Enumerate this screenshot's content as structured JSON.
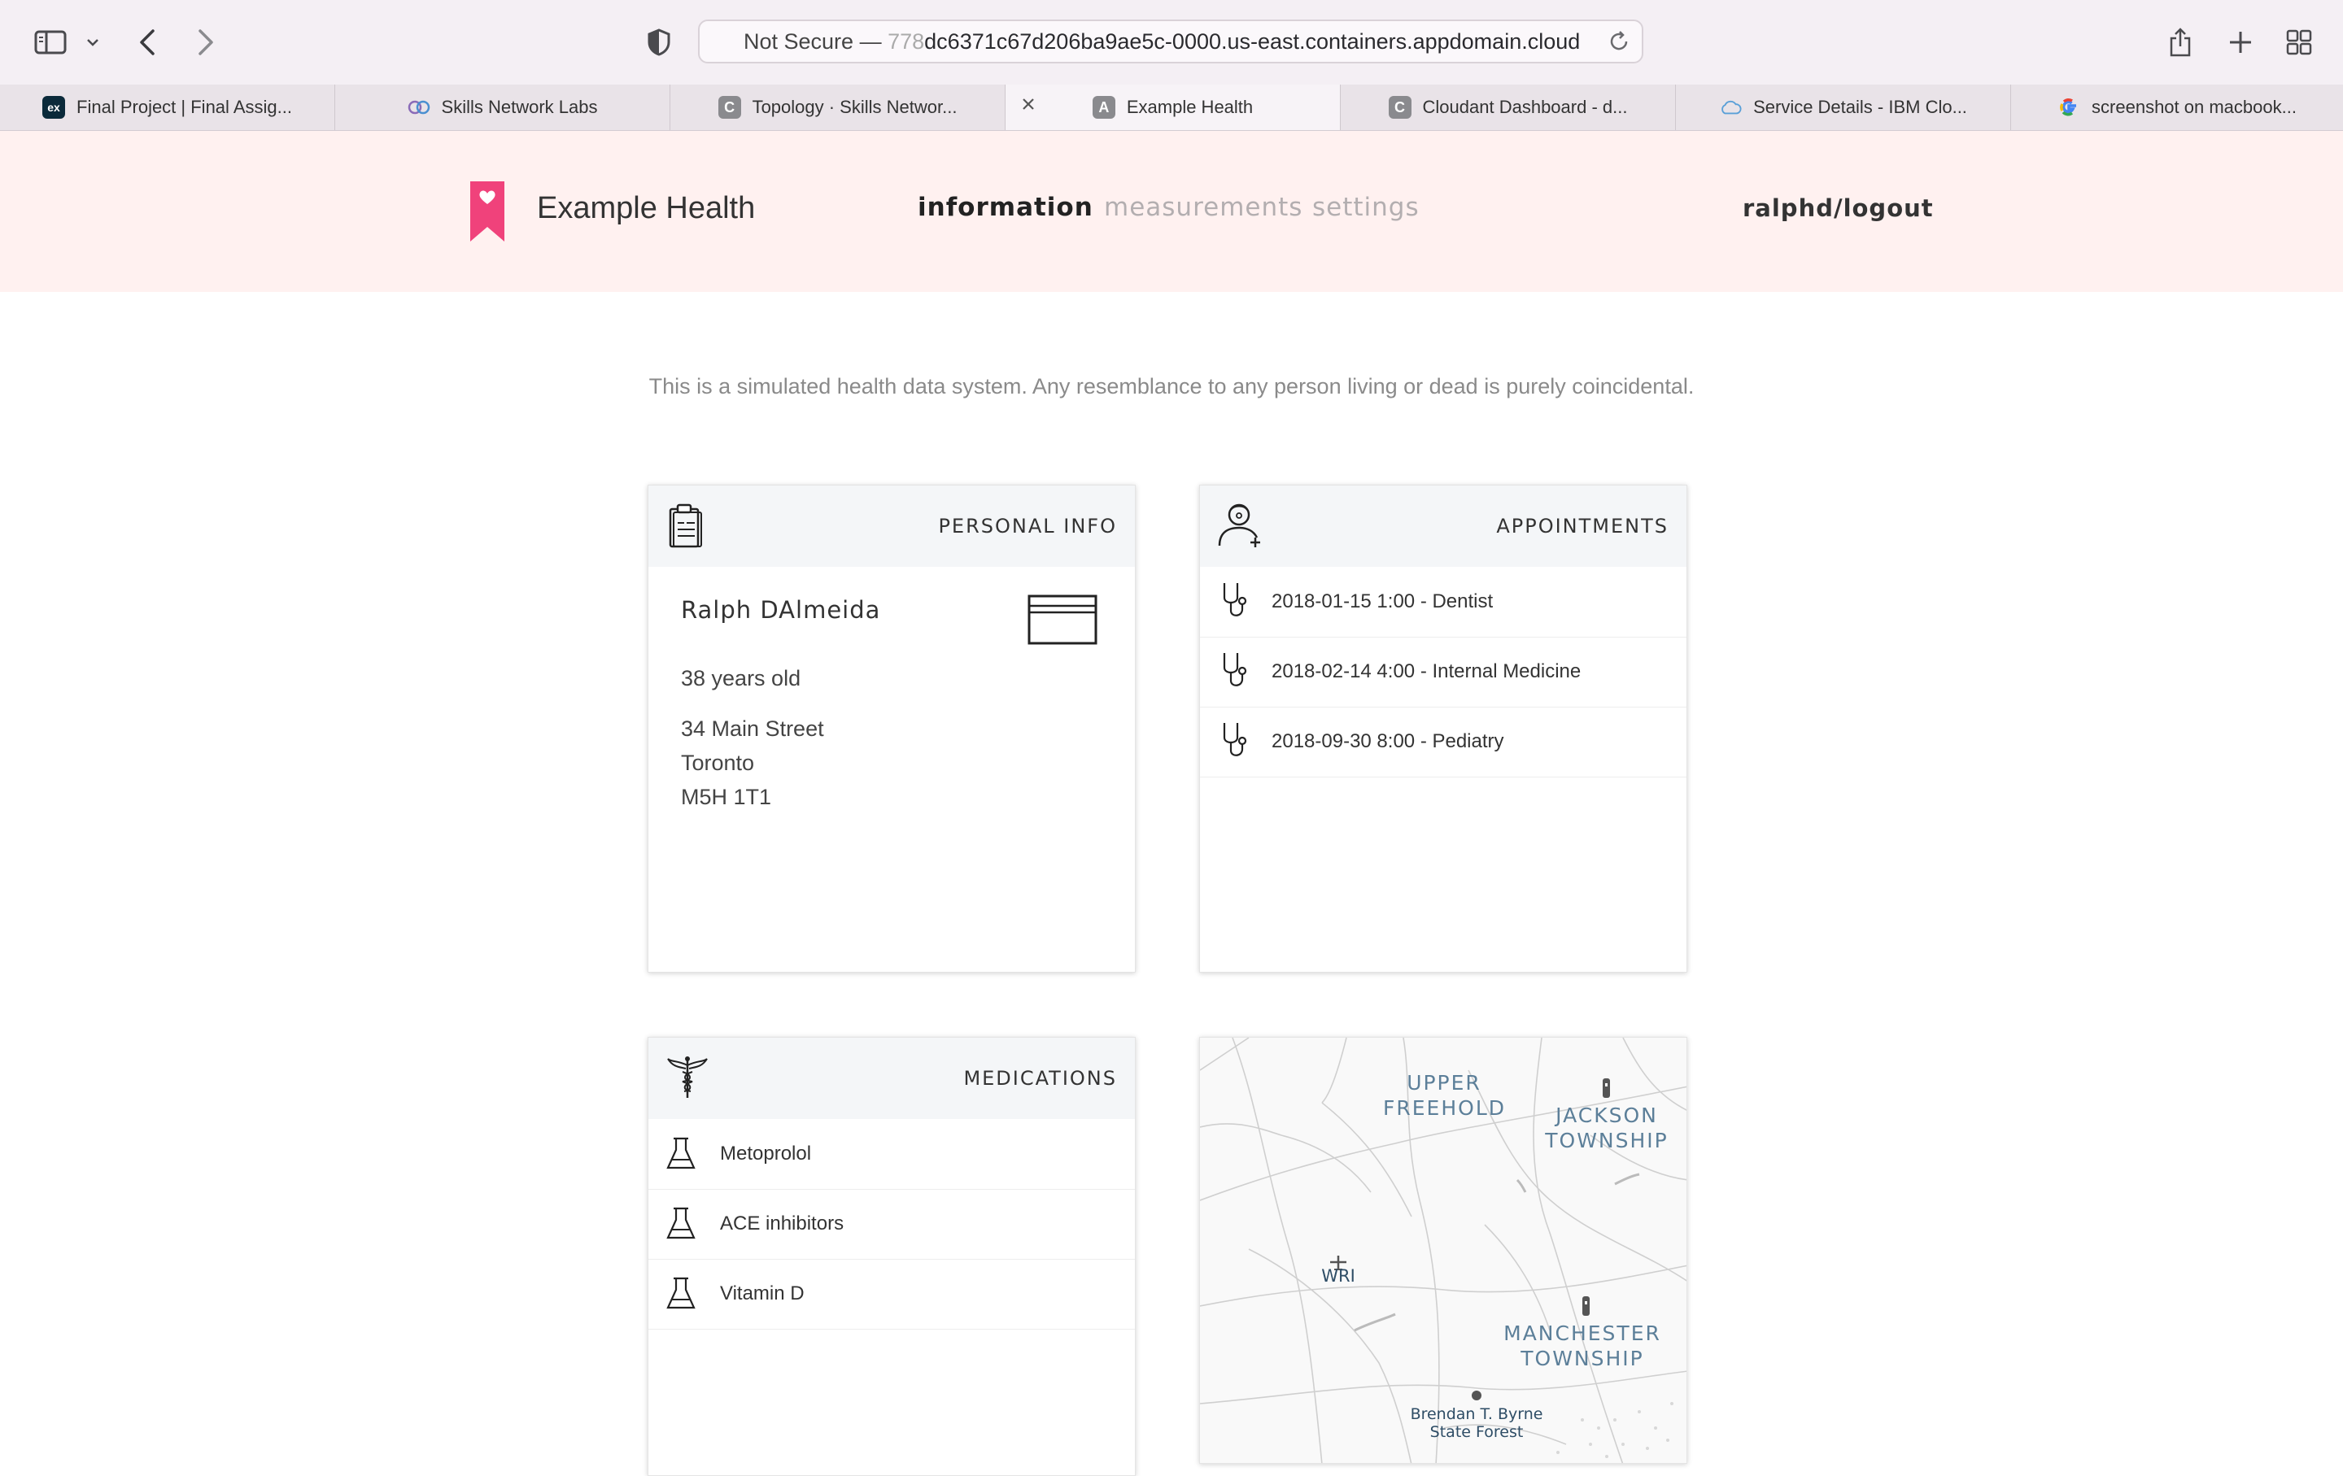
{
  "browser": {
    "address_prefix": "Not Secure —",
    "address_faded": "778",
    "address_url": "dc6371c67d206ba9ae5c-0000.us-east.containers.appdomain.cloud",
    "tabs": [
      {
        "label": "Final Project | Final Assig...",
        "favicon": "edx"
      },
      {
        "label": "Skills Network Labs",
        "favicon": "skills"
      },
      {
        "label": "Topology · Skills Networ...",
        "favicon": "C"
      },
      {
        "label": "Example Health",
        "favicon": "A"
      },
      {
        "label": "Cloudant Dashboard - d...",
        "favicon": "C"
      },
      {
        "label": "Service Details - IBM Clo...",
        "favicon": "cloud"
      },
      {
        "label": "screenshot on macbook...",
        "favicon": "G"
      }
    ]
  },
  "app": {
    "name": "Example Health",
    "brand_color": "#f0427b",
    "nav": {
      "information": "information",
      "measurements": "measurements",
      "settings": "settings"
    },
    "logout": "ralphd/logout"
  },
  "disclaimer": "This is a simulated health data system. Any resemblance to any person living or dead is purely coincidental.",
  "personal_info": {
    "title": "PERSONAL INFO",
    "name": "Ralph DAlmeida",
    "age": "38 years old",
    "street": "34 Main Street",
    "city": "Toronto",
    "postal": "M5H 1T1"
  },
  "appointments": {
    "title": "APPOINTMENTS",
    "items": [
      "2018-01-15 1:00 - Dentist",
      "2018-02-14 4:00 - Internal Medicine",
      "2018-09-30 8:00 - Pediatry"
    ]
  },
  "medications": {
    "title": "MEDICATIONS",
    "items": [
      "Metoprolol",
      "ACE inhibitors",
      "Vitamin D"
    ]
  },
  "map": {
    "labels": {
      "upper_freehold_1": "UPPER",
      "upper_freehold_2": "FREEHOLD",
      "jackson_1": "JACKSON",
      "jackson_2": "TOWNSHIP",
      "wri": "WRI",
      "manchester_1": "MANCHESTER",
      "manchester_2": "TOWNSHIP",
      "forest_1": "Brendan T. Byrne",
      "forest_2": "State Forest"
    }
  }
}
